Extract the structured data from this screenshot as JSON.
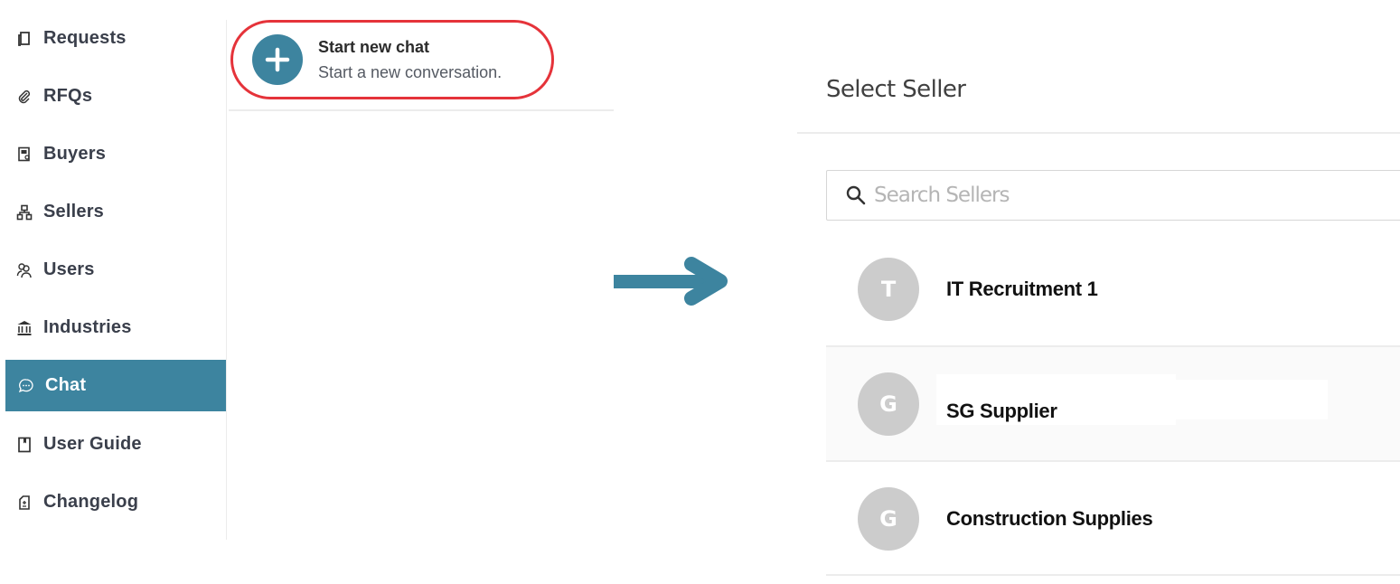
{
  "sidebar": {
    "items": [
      {
        "label": "Requests",
        "icon": "document-copy-icon",
        "active": false
      },
      {
        "label": "RFQs",
        "icon": "paperclip-icon",
        "active": false
      },
      {
        "label": "Buyers",
        "icon": "id-badge-icon",
        "active": false
      },
      {
        "label": "Sellers",
        "icon": "org-chart-icon",
        "active": false
      },
      {
        "label": "Users",
        "icon": "users-add-icon",
        "active": false
      },
      {
        "label": "Industries",
        "icon": "bank-icon",
        "active": false
      },
      {
        "label": "Chat",
        "icon": "chat-bubble-icon",
        "active": true
      },
      {
        "label": "User Guide",
        "icon": "book-icon",
        "active": false
      },
      {
        "label": "Changelog",
        "icon": "changelog-file-icon",
        "active": false
      }
    ]
  },
  "chat_panel": {
    "start_chat_title": "Start new chat",
    "start_chat_subtitle": "Start a new conversation."
  },
  "seller_panel": {
    "title": "Select Seller",
    "search_placeholder": "Search Sellers",
    "search_value": "",
    "sellers": [
      {
        "initial": "T",
        "name": "IT Recruitment 1"
      },
      {
        "initial": "G",
        "name": "SG Supplier"
      },
      {
        "initial": "G",
        "name": "Construction Supplies"
      }
    ]
  },
  "colors": {
    "accent": "#3d849f",
    "highlight_ring": "#e5333a",
    "avatar_bg": "#cccccc"
  }
}
